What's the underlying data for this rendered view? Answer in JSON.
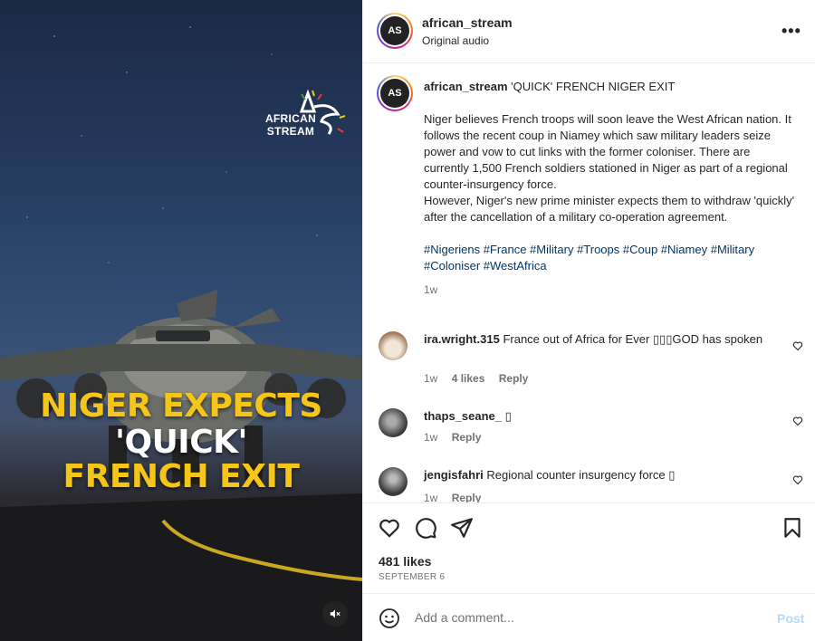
{
  "media": {
    "brand_text_line1": "AFRICAN",
    "brand_text_line2": "STREAM",
    "headline": [
      "NIGER EXPECTS",
      "'QUICK'",
      "FRENCH EXIT"
    ],
    "mute_icon": "speaker-muted-icon"
  },
  "header": {
    "username": "african_stream",
    "audio": "Original audio",
    "more_icon": "more-horizontal-icon",
    "more_label": "•••"
  },
  "caption": {
    "username": "african_stream",
    "title": "'QUICK' FRENCH NIGER EXIT",
    "body": "Niger believes French troops will soon leave the West African nation. It follows the recent coup in Niamey which saw military leaders seize power and vow to cut links with the former coloniser. There are currently 1,500 French soldiers stationed in Niger as part of a regional counter-insurgency force.",
    "body2": "However, Niger's new prime minister expects them to withdraw 'quickly' after the cancellation of a military co-operation agreement.",
    "tags": "#Nigeriens #France #Military #Troops #Coup #Niamey #Military #Coloniser #WestAfrica",
    "time": "1w"
  },
  "comments": [
    {
      "username": "ira.wright.315",
      "text": "France out of Africa for Ever ▯▯▯GOD has spoken",
      "time": "1w",
      "likes": "4 likes",
      "reply": "Reply"
    },
    {
      "username": "thaps_seane_",
      "text": "▯",
      "time": "1w",
      "reply": "Reply"
    },
    {
      "username": "jengisfahri",
      "text": "Regional counter insurgency force ▯",
      "time": "1w",
      "reply": "Reply"
    }
  ],
  "actions": {
    "likes": "481 likes",
    "date": "SEPTEMBER 6"
  },
  "add_comment": {
    "placeholder": "Add a comment...",
    "post_label": "Post"
  },
  "colors": {
    "headline_yellow": "#f5c518",
    "link_blue": "#00376b",
    "post_disabled": "#b3dbff"
  }
}
